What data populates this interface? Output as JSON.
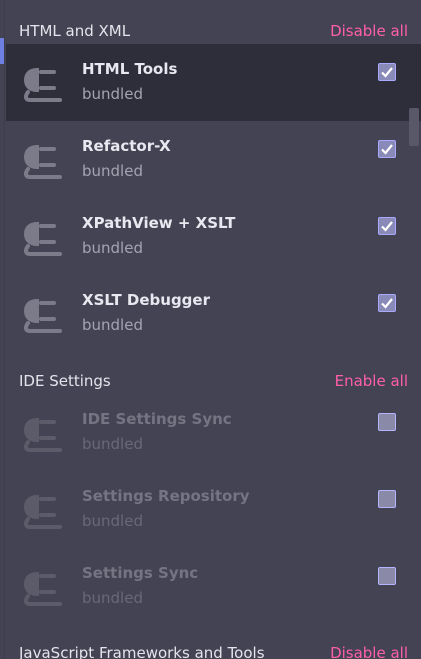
{
  "sections": [
    {
      "title": "HTML and XML",
      "action": "Disable all",
      "plugins": [
        {
          "name": "HTML Tools",
          "sub": "bundled",
          "checked": true,
          "selected": true
        },
        {
          "name": "Refactor-X",
          "sub": "bundled",
          "checked": true
        },
        {
          "name": "XPathView + XSLT",
          "sub": "bundled",
          "checked": true
        },
        {
          "name": "XSLT Debugger",
          "sub": "bundled",
          "checked": true
        }
      ]
    },
    {
      "title": "IDE Settings",
      "action": "Enable all",
      "plugins": [
        {
          "name": "IDE Settings Sync",
          "sub": "bundled",
          "checked": false
        },
        {
          "name": "Settings Repository",
          "sub": "bundled",
          "checked": false
        },
        {
          "name": "Settings Sync",
          "sub": "bundled",
          "checked": false
        }
      ]
    },
    {
      "title": "JavaScript Frameworks and Tools",
      "action": "Disable all",
      "plugins": []
    }
  ],
  "colors": {
    "background": "#434353",
    "selected_row": "#2e2e3b",
    "action_link": "#ff5fa8",
    "checkbox": "#8a8ab8"
  },
  "icons": {
    "plugin": "plug-icon",
    "check": "checkmark-icon"
  }
}
